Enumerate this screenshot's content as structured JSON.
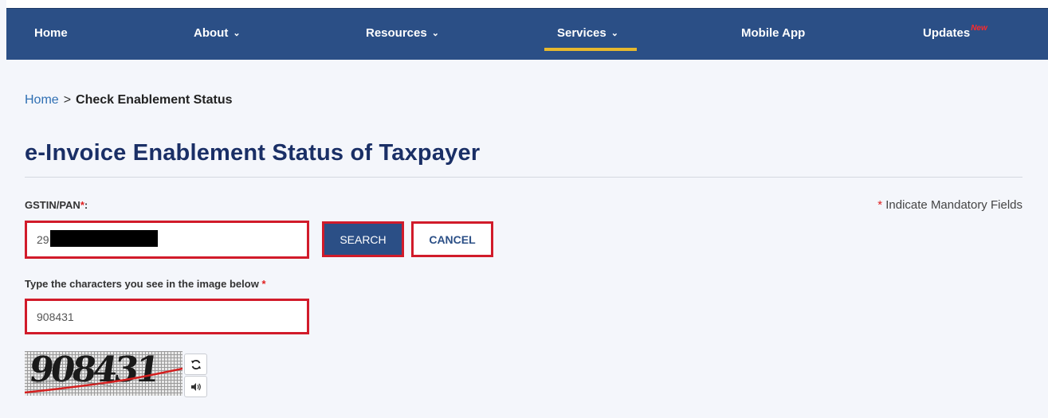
{
  "nav": {
    "items": [
      {
        "label": "Home"
      },
      {
        "label": "About",
        "chevron": "⌄"
      },
      {
        "label": "Resources",
        "chevron": "⌄"
      },
      {
        "label": "Services",
        "chevron": "⌄",
        "active": true
      },
      {
        "label": "Mobile App"
      },
      {
        "label": "Updates",
        "badge": "New"
      }
    ],
    "bg_color": "#2b4f86",
    "active_underline_color": "#e6b82e"
  },
  "breadcrumb": {
    "home": "Home",
    "separator": ">",
    "current": "Check Enablement Status"
  },
  "page": {
    "title": "e-Invoice Enablement Status of Taxpayer",
    "mandatory_star": "*",
    "mandatory_note": "Indicate Mandatory Fields"
  },
  "form": {
    "gstin_label": "GSTIN/PAN",
    "gstin_required": "*",
    "gstin_suffix": ":",
    "gstin_value": "29",
    "search_label": "SEARCH",
    "cancel_label": "CANCEL",
    "captcha_label": "Type the characters you see in the image below",
    "captcha_required": "*",
    "captcha_value": "908431"
  },
  "captcha": {
    "image_text": "908431",
    "refresh_icon": "refresh-icon",
    "audio_icon": "audio-icon"
  },
  "colors": {
    "accent": "#2b4f86",
    "highlight_border": "#d11b2a",
    "required": "#e02020",
    "link": "#2f6fb3"
  }
}
